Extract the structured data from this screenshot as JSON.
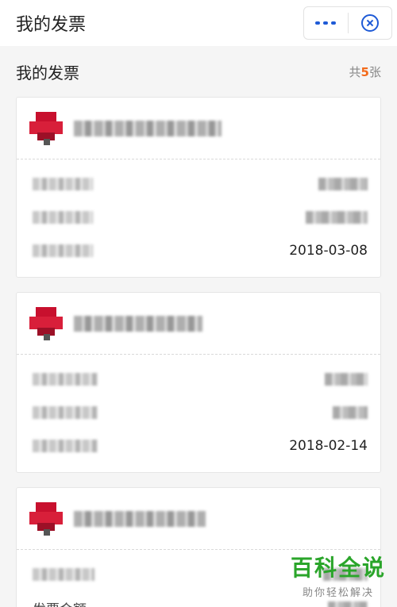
{
  "topbar": {
    "title": "我的发票",
    "more_icon": "more-dots-icon",
    "close_icon": "circle-close-icon",
    "accent_color": "#1e5ad6"
  },
  "section": {
    "label": "我的发票",
    "count_prefix": "共",
    "count": "5",
    "count_suffix": "张",
    "count_color": "#f36b1c"
  },
  "invoices": [
    {
      "date": "2018-03-08"
    },
    {
      "date": "2018-02-14"
    },
    {
      "amount_label": "发票金额"
    }
  ],
  "watermark": {
    "main": "百科全说",
    "sub": "助你轻松解决"
  }
}
